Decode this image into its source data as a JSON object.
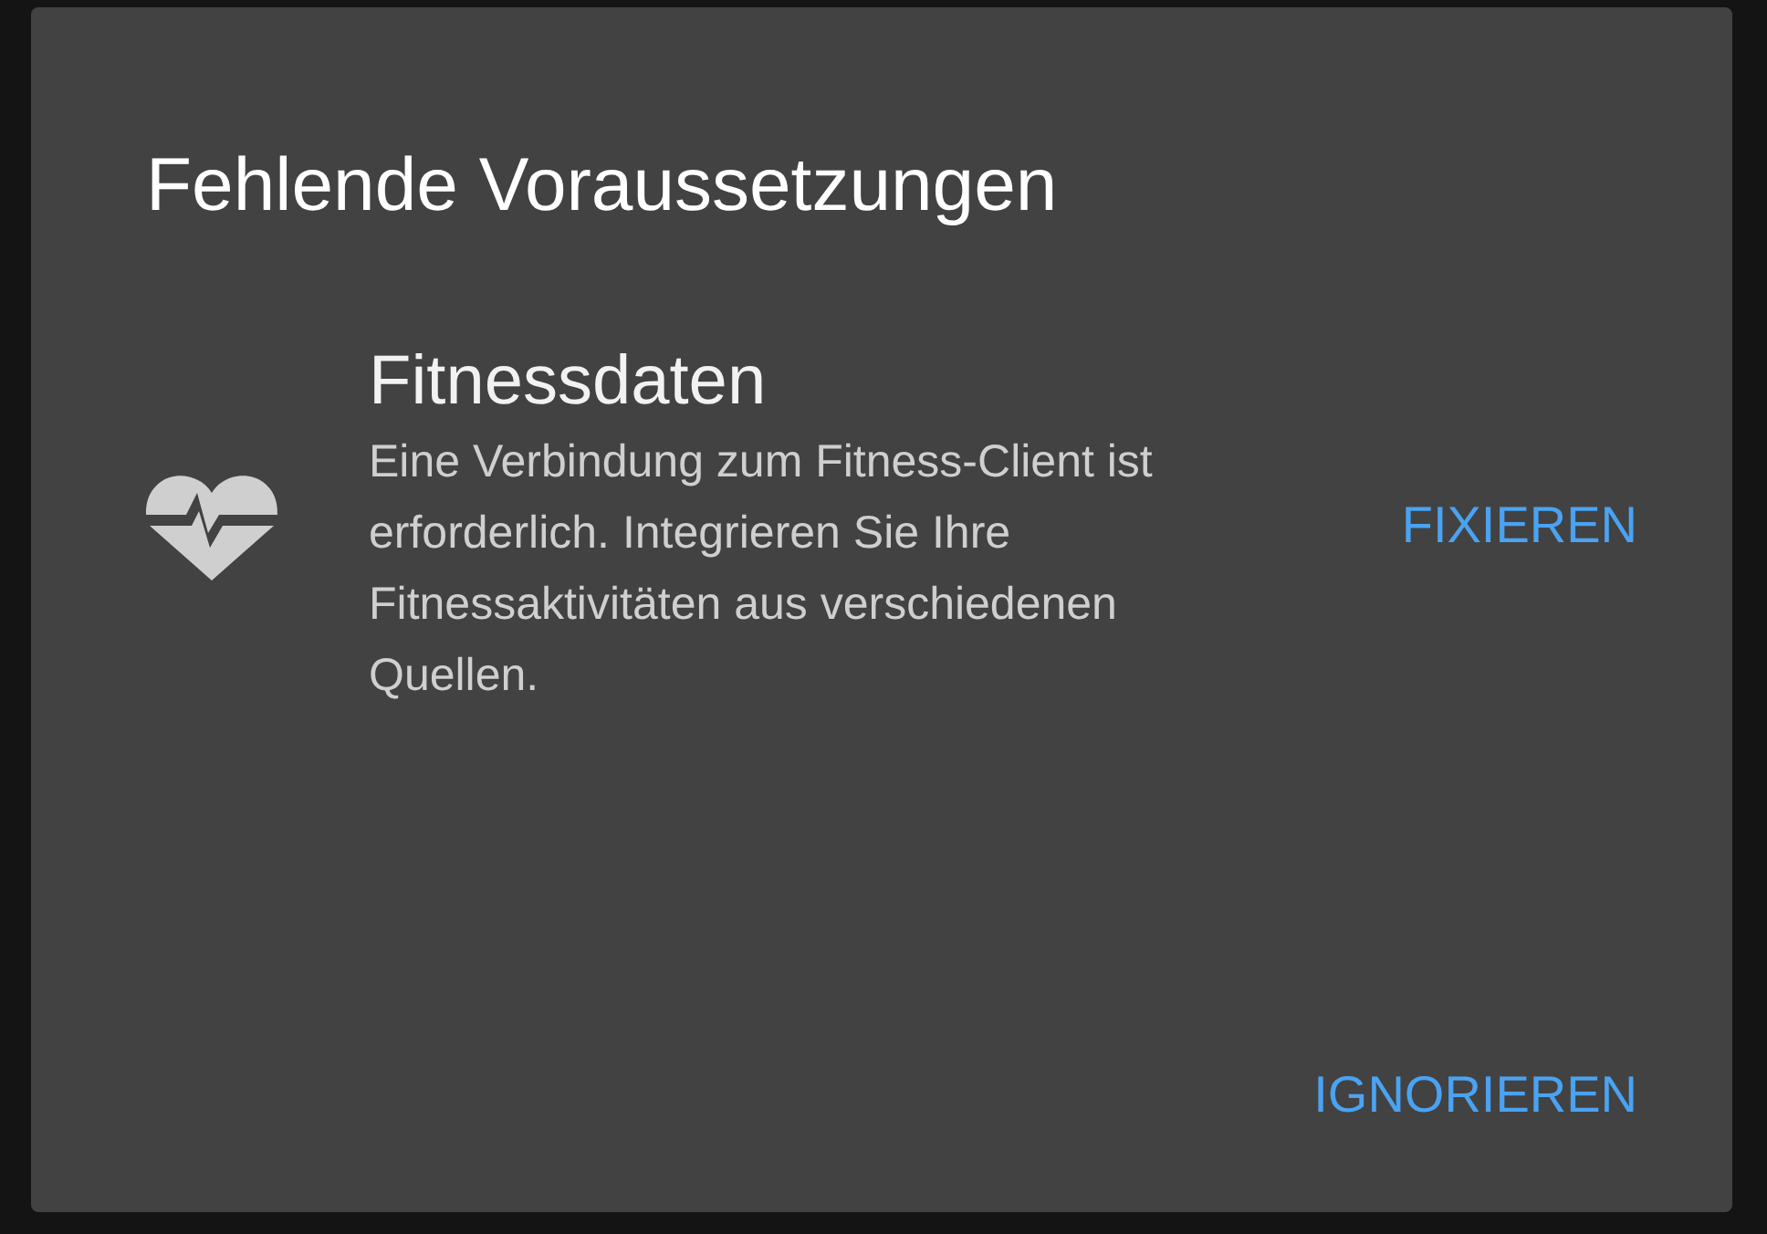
{
  "dialog": {
    "title": "Fehlende Voraussetzungen",
    "items": [
      {
        "kind": "heart",
        "title": "Fitnessdaten",
        "description": "Eine Verbindung zum Fitness-Client ist erforderlich. Integrieren Sie Ihre Fitnessaktivitäten aus verschiedenen Quellen.",
        "action": "FIXIEREN"
      }
    ],
    "buttons": [
      "IGNORIEREN"
    ]
  }
}
